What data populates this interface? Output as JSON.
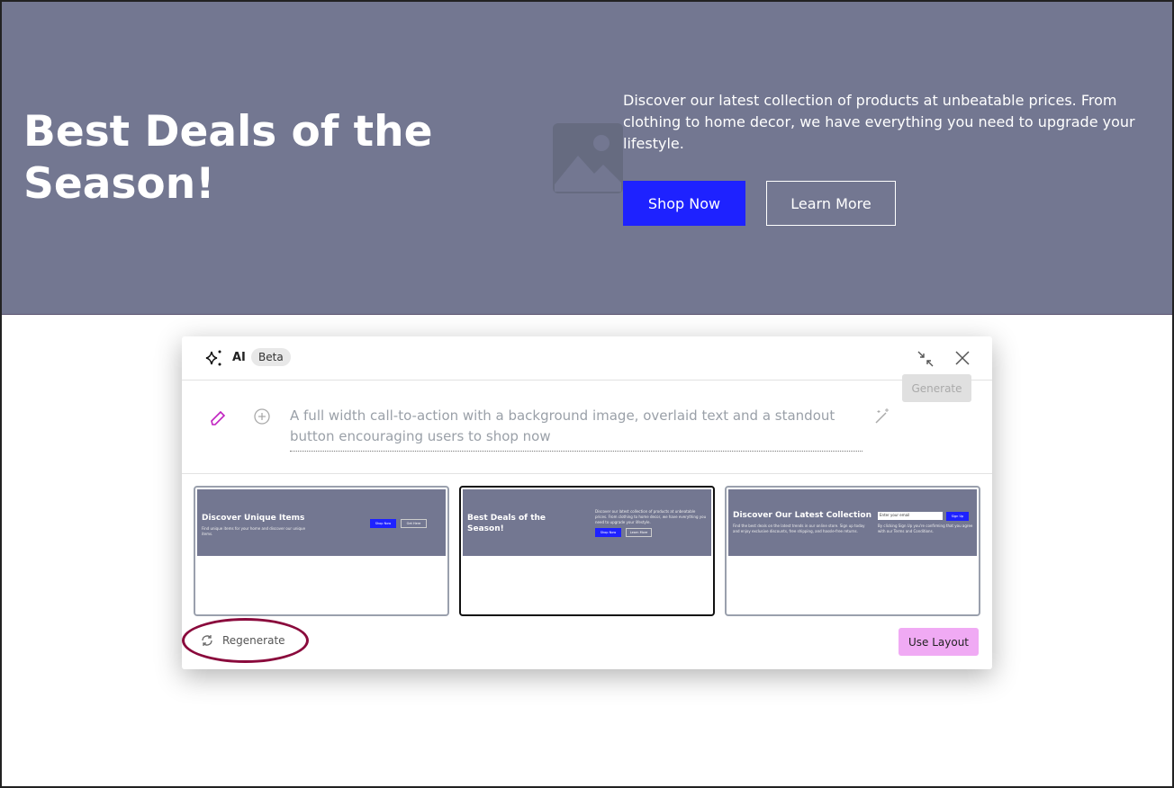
{
  "hero": {
    "title": "Best Deals of the Season!",
    "description": "Discover our latest collection of products at unbeatable prices. From clothing to home decor, we have everything you need to upgrade your lifestyle.",
    "shop_label": "Shop Now",
    "learn_label": "Learn More",
    "background": "#737791",
    "accent": "#1e22ff"
  },
  "modal": {
    "title": "AI",
    "badge": "Beta",
    "prompt": "A full width call-to-action with a background image, overlaid text and a standout button encouraging users to shop now",
    "generate_label": "Generate",
    "regenerate_label": "Regenerate",
    "use_layout_label": "Use Layout",
    "use_layout_color": "#f0aaf4",
    "thumbnails": [
      {
        "title": "Discover Unique Items",
        "text": "Find unique items for your home and discover our unique items.",
        "btn1": "Shop Now",
        "btn2": "Get Here"
      },
      {
        "title": "Best Deals of the Season!",
        "text": "Discover our latest collection of products at unbeatable prices. From clothing to home decor, we have everything you need to upgrade your lifestyle.",
        "btn1": "Shop Now",
        "btn2": "Learn More"
      },
      {
        "title": "Discover Our Latest Collection",
        "text": "Find the best deals on the latest trends in our online store. Sign up today and enjoy exclusive discounts, free shipping, and hassle-free returns.",
        "input": "Enter your email",
        "btn1": "Sign Up",
        "note": "By clicking Sign Up you're confirming that you agree with our Terms and Conditions."
      }
    ]
  }
}
